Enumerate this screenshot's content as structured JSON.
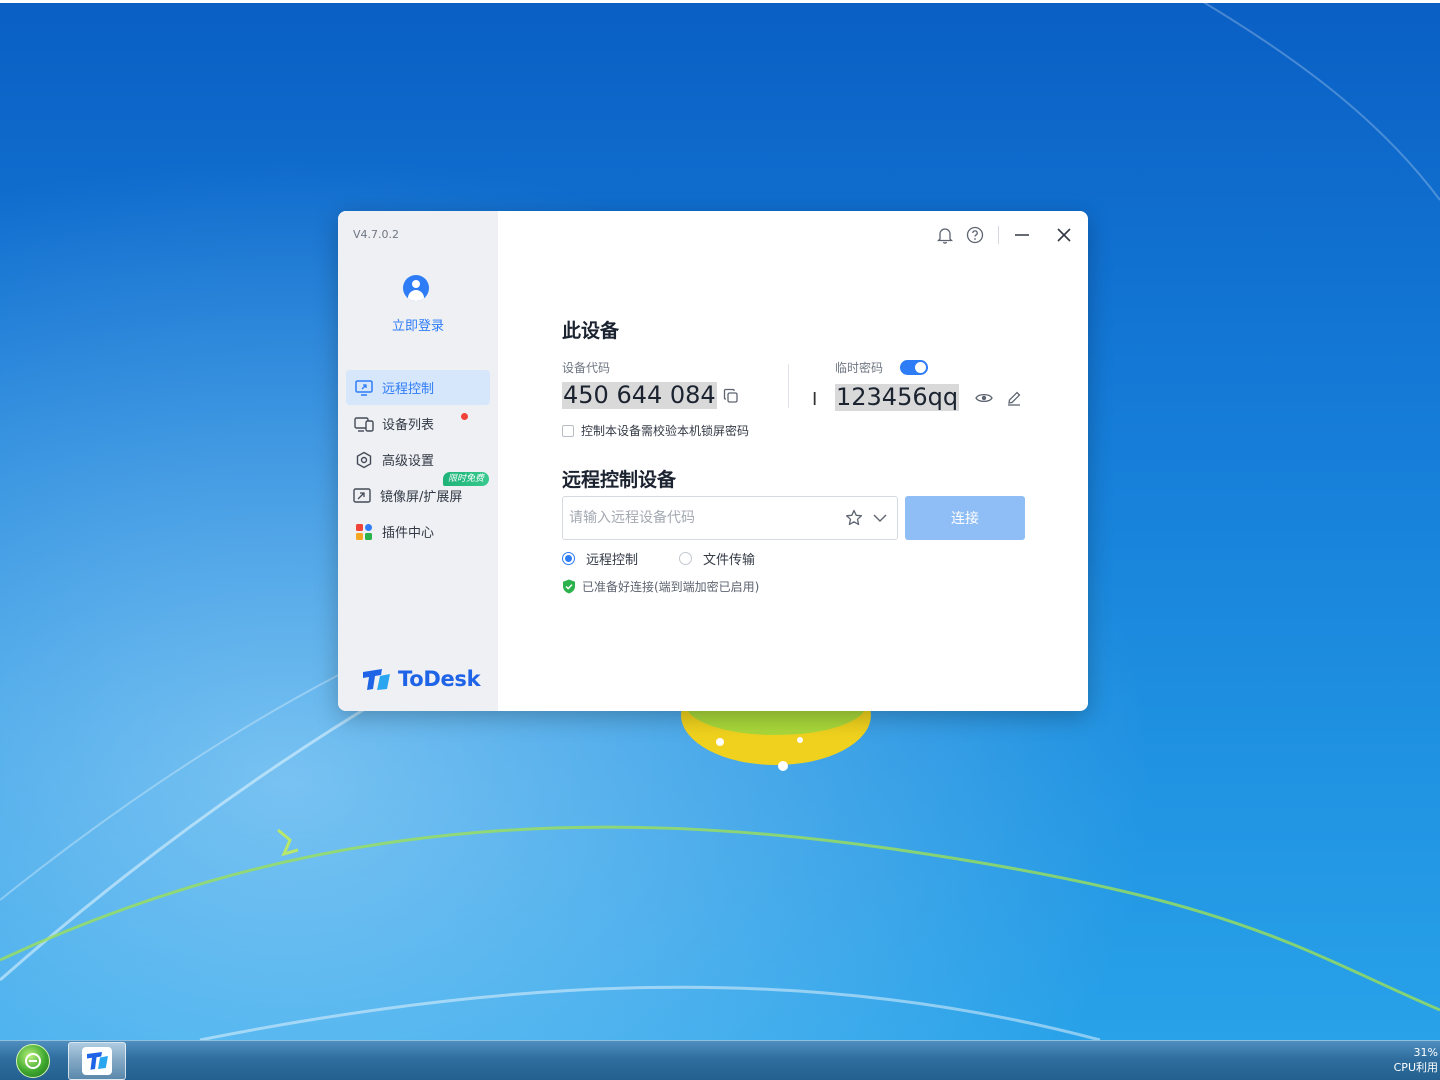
{
  "window": {
    "version": "V4.7.0.2",
    "login_label": "立即登录",
    "brand_name": "ToDesk"
  },
  "sidebar": {
    "items": [
      {
        "label": "远程控制",
        "icon": "monitor-icon",
        "active": true
      },
      {
        "label": "设备列表",
        "icon": "devices-icon",
        "has_dot": true
      },
      {
        "label": "高级设置",
        "icon": "gear-hexagon-icon"
      },
      {
        "label": "镜像屏/扩展屏",
        "icon": "screen-mirror-icon",
        "badge": "限时免费"
      },
      {
        "label": "插件中心",
        "icon": "plugin-grid-icon"
      }
    ]
  },
  "this_device": {
    "title": "此设备",
    "code_label": "设备代码",
    "code": "450 644 084",
    "temp_password_label": "临时密码",
    "temp_password": "123456qq",
    "temp_password_enabled": true,
    "lockscreen_check_label": "控制本设备需校验本机锁屏密码",
    "lockscreen_check_checked": false
  },
  "remote": {
    "title": "远程控制设备",
    "input_placeholder": "请输入远程设备代码",
    "input_value": "",
    "connect_label": "连接",
    "mode_remote_label": "远程控制",
    "mode_file_label": "文件传输",
    "selected_mode": "远程控制",
    "status_text": "已准备好连接(端到端加密已启用)"
  },
  "taskbar": {
    "cpu_percent": "31%",
    "cpu_label": "CPU利用"
  },
  "colors": {
    "accent": "#2e7cf6",
    "connect_disabled": "#8fbdf5",
    "sidebar_bg": "#eef0f4",
    "status_ok": "#2bb24c"
  }
}
